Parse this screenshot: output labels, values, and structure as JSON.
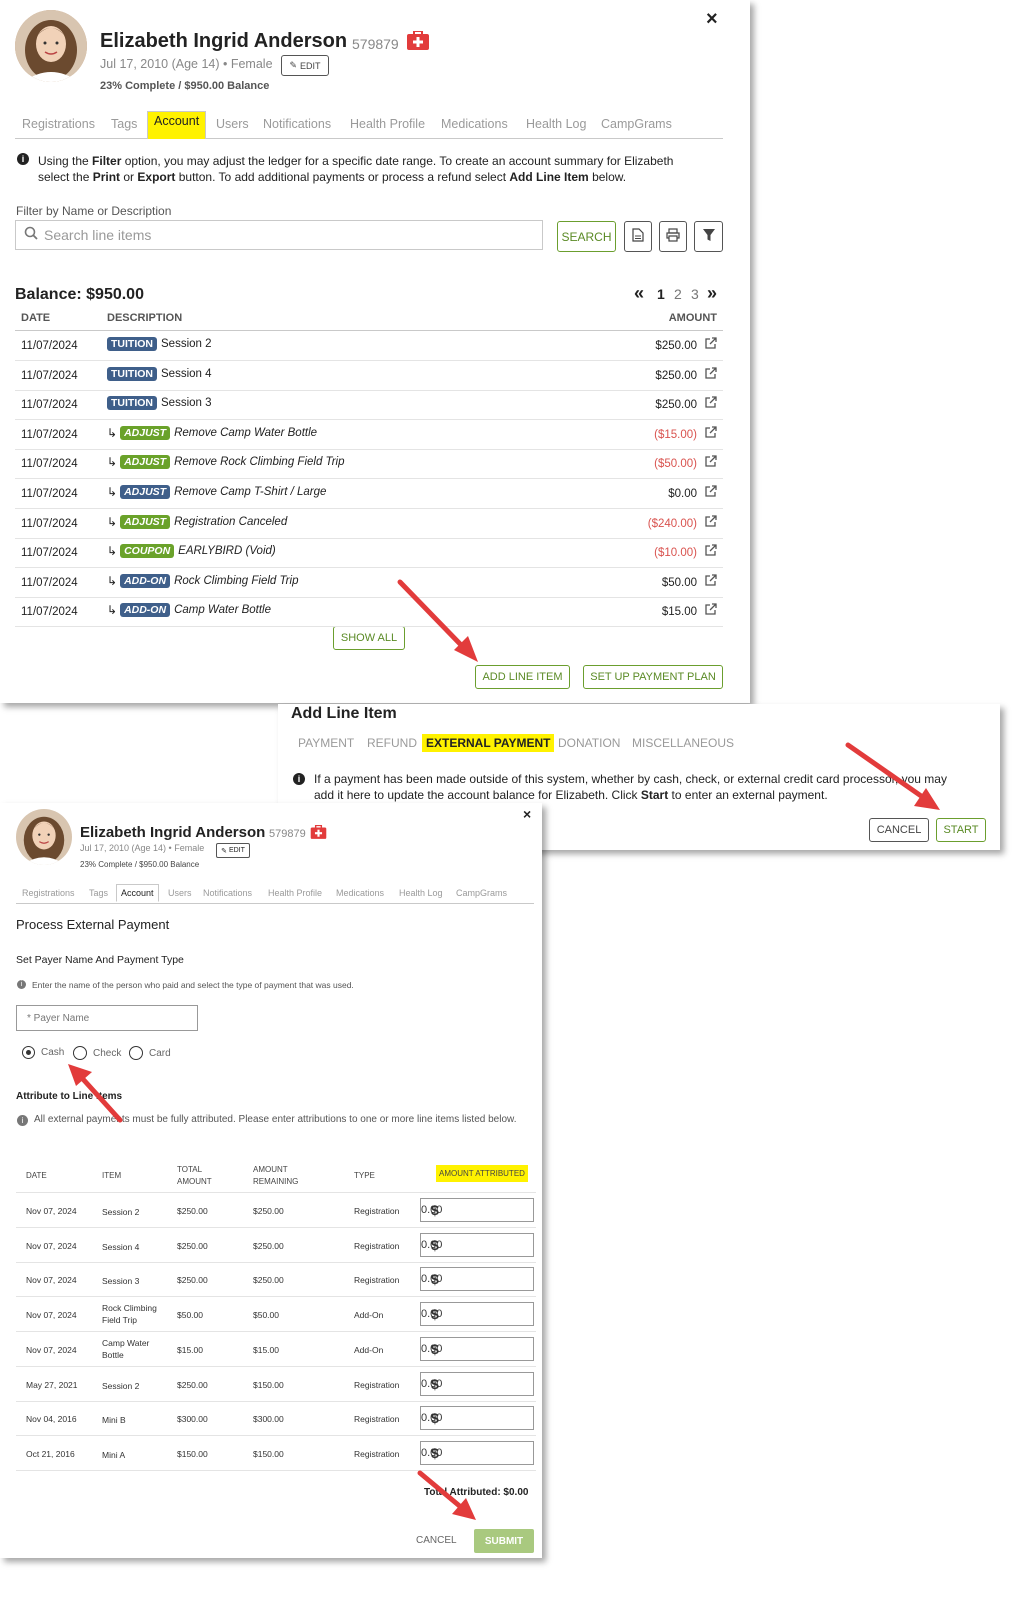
{
  "top": {
    "name": "Elizabeth Ingrid Anderson",
    "id": "579879",
    "sub": "Jul 17, 2010 (Age 14) • Female",
    "edit": "EDIT",
    "progress": "23% Complete / $950.00 Balance",
    "close": "×",
    "tabs": [
      "Registrations",
      "Tags",
      "Account",
      "Users",
      "Notifications",
      "Health Profile",
      "Medications",
      "Health Log",
      "CampGrams"
    ],
    "info_parts": [
      "Using the ",
      "Filter",
      " option, you may adjust the ledger for a specific date range. To create an account summary for Elizabeth"
    ],
    "info2_parts": [
      "select the ",
      "Print",
      " or ",
      "Export",
      " button. To add additional payments or process a refund select ",
      "Add Line Item",
      " below."
    ],
    "filter_label": "Filter by Name or Description",
    "search_placeholder": "Search line items",
    "search_btn": "SEARCH",
    "balance": "Balance: $950.00",
    "pages": [
      "1",
      "2",
      "3"
    ],
    "first": "«",
    "last": "»",
    "columns": {
      "date": "DATE",
      "desc": "DESCRIPTION",
      "amount": "AMOUNT"
    },
    "rows": [
      {
        "date": "11/07/2024",
        "badge": "TUITION",
        "kind": "tuition",
        "desc": "Session 2",
        "amount": "$250.00",
        "neg": false,
        "sub": false
      },
      {
        "date": "11/07/2024",
        "badge": "TUITION",
        "kind": "tuition",
        "desc": "Session 4",
        "amount": "$250.00",
        "neg": false,
        "sub": false
      },
      {
        "date": "11/07/2024",
        "badge": "TUITION",
        "kind": "tuition",
        "desc": "Session 3",
        "amount": "$250.00",
        "neg": false,
        "sub": false
      },
      {
        "date": "11/07/2024",
        "badge": "ADJUST",
        "kind": "adjust",
        "desc": "Remove Camp Water Bottle",
        "amount": "($15.00)",
        "neg": true,
        "sub": true
      },
      {
        "date": "11/07/2024",
        "badge": "ADJUST",
        "kind": "adjust",
        "desc": "Remove Rock Climbing Field Trip",
        "amount": "($50.00)",
        "neg": true,
        "sub": true
      },
      {
        "date": "11/07/2024",
        "badge": "ADJUST",
        "kind": "adjust-blue",
        "desc": "Remove Camp T-Shirt / Large",
        "amount": "$0.00",
        "neg": false,
        "sub": true
      },
      {
        "date": "11/07/2024",
        "badge": "ADJUST",
        "kind": "adjust",
        "desc": "Registration Canceled",
        "amount": "($240.00)",
        "neg": true,
        "sub": true
      },
      {
        "date": "11/07/2024",
        "badge": "COUPON",
        "kind": "coupon",
        "desc": "EARLYBIRD (Void)",
        "amount": "($10.00)",
        "neg": true,
        "sub": true
      },
      {
        "date": "11/07/2024",
        "badge": "ADD-ON",
        "kind": "addon",
        "desc": "Rock Climbing Field Trip",
        "amount": "$50.00",
        "neg": false,
        "sub": true
      },
      {
        "date": "11/07/2024",
        "badge": "ADD-ON",
        "kind": "addon",
        "desc": "Camp Water Bottle",
        "amount": "$15.00",
        "neg": false,
        "sub": true
      }
    ],
    "show_all": "SHOW ALL",
    "add_line_item": "ADD LINE ITEM",
    "payment_plan": "SET UP PAYMENT PLAN"
  },
  "middle": {
    "title": "Add Line Item",
    "tabs": [
      "PAYMENT",
      "REFUND",
      "EXTERNAL PAYMENT",
      "DONATION",
      "MISCELLANEOUS"
    ],
    "info1": "If a payment has been made outside of this system, whether by cash, check, or external credit card processor, you may",
    "info2_parts": [
      "add it here to update the account balance for Elizabeth. Click ",
      "Start",
      " to enter an external payment."
    ],
    "cancel": "CANCEL",
    "start": "START"
  },
  "bottom": {
    "name": "Elizabeth Ingrid Anderson",
    "id": "579879",
    "sub": "Jul 17, 2010 (Age 14) • Female",
    "edit": "EDIT",
    "progress": "23% Complete / $950.00 Balance",
    "close": "×",
    "tabs": [
      "Registrations",
      "Tags",
      "Account",
      "Users",
      "Notifications",
      "Health Profile",
      "Medications",
      "Health Log",
      "CampGrams"
    ],
    "heading": "Process External Payment",
    "section1": "Set Payer Name And Payment Type",
    "info1": "Enter the name of the person who paid and select the type of payment that was used.",
    "payer_placeholder": "* Payer Name",
    "radios": [
      "Cash",
      "Check",
      "Card"
    ],
    "section2": "Attribute to Line Items",
    "info2": "All external payments must be fully attributed. Please enter attributions to one or more line items listed below.",
    "columns": {
      "date": "DATE",
      "item": "ITEM",
      "total": "TOTAL AMOUNT",
      "remaining": "AMOUNT REMAINING",
      "type": "TYPE",
      "attributed": "AMOUNT ATTRIBUTED"
    },
    "rows": [
      {
        "date": "Nov 07, 2024",
        "item": "Session 2",
        "total": "$250.00",
        "remaining": "$250.00",
        "type": "Registration",
        "value": "0.00"
      },
      {
        "date": "Nov 07, 2024",
        "item": "Session 4",
        "total": "$250.00",
        "remaining": "$250.00",
        "type": "Registration",
        "value": "0.00"
      },
      {
        "date": "Nov 07, 2024",
        "item": "Session 3",
        "total": "$250.00",
        "remaining": "$250.00",
        "type": "Registration",
        "value": "0.00"
      },
      {
        "date": "Nov 07, 2024",
        "item": "Rock Climbing Field Trip",
        "total": "$50.00",
        "remaining": "$50.00",
        "type": "Add-On",
        "value": "0.00"
      },
      {
        "date": "Nov 07, 2024",
        "item": "Camp Water Bottle",
        "total": "$15.00",
        "remaining": "$15.00",
        "type": "Add-On",
        "value": "0.00"
      },
      {
        "date": "May 27, 2021",
        "item": "Session 2",
        "total": "$250.00",
        "remaining": "$150.00",
        "type": "Registration",
        "value": "0.00"
      },
      {
        "date": "Nov 04, 2016",
        "item": "Mini B",
        "total": "$300.00",
        "remaining": "$300.00",
        "type": "Registration",
        "value": "0.00"
      },
      {
        "date": "Oct 21, 2016",
        "item": "Mini A",
        "total": "$150.00",
        "remaining": "$150.00",
        "type": "Registration",
        "value": "0.00"
      }
    ],
    "total_attributed": "Total Attributed: $0.00",
    "cancel": "CANCEL",
    "submit": "SUBMIT",
    "currency": "$"
  },
  "colors": {
    "accent": "#6b9e2e",
    "highlight": "#fff200",
    "badge_blue": "#3f5f8a",
    "badge_green": "#6aa22a",
    "negative": "#d9534f",
    "arrow": "#e23b3b"
  },
  "icons": [
    "close-icon",
    "medical-icon",
    "pencil-icon",
    "info-icon",
    "search-icon",
    "document-icon",
    "print-icon",
    "filter-icon",
    "external-link-icon",
    "arrow-icon"
  ]
}
